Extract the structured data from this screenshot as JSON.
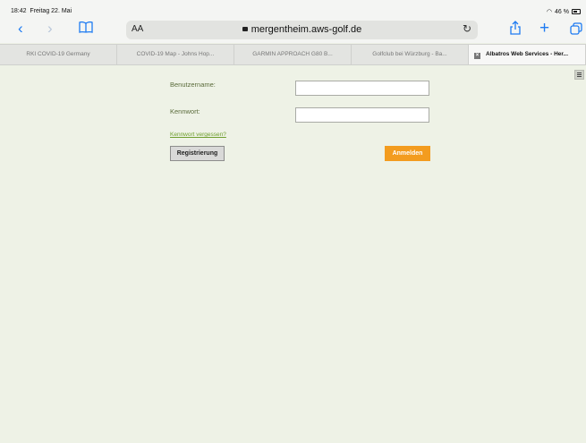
{
  "statusbar": {
    "time": "18:42",
    "date": "Freitag 22. Mai",
    "battery": "46 %",
    "wifi_icon": "wifi-icon"
  },
  "browser": {
    "aa_label": "AA",
    "url": "mergentheim.aws-golf.de",
    "accent_color": "#1e7bf2",
    "tabs": [
      {
        "title": "RKI COVID-19 Germany"
      },
      {
        "title": "COVID-19 Map - Johns Hop..."
      },
      {
        "title": "GARMIN APPROACH G80 B..."
      },
      {
        "title": "Golfclub bei Würzburg - Ba..."
      },
      {
        "title": "Albatros Web Services - Her..."
      }
    ]
  },
  "login": {
    "username_label": "Benutzername:",
    "username_value": "",
    "password_label": "Kennwort:",
    "password_value": "",
    "forgot_link": "Kennwort vergessen?",
    "register_button": "Registrierung",
    "login_button": "Anmelden",
    "login_button_color": "#f39c1f",
    "label_color": "#5a6b3a"
  }
}
